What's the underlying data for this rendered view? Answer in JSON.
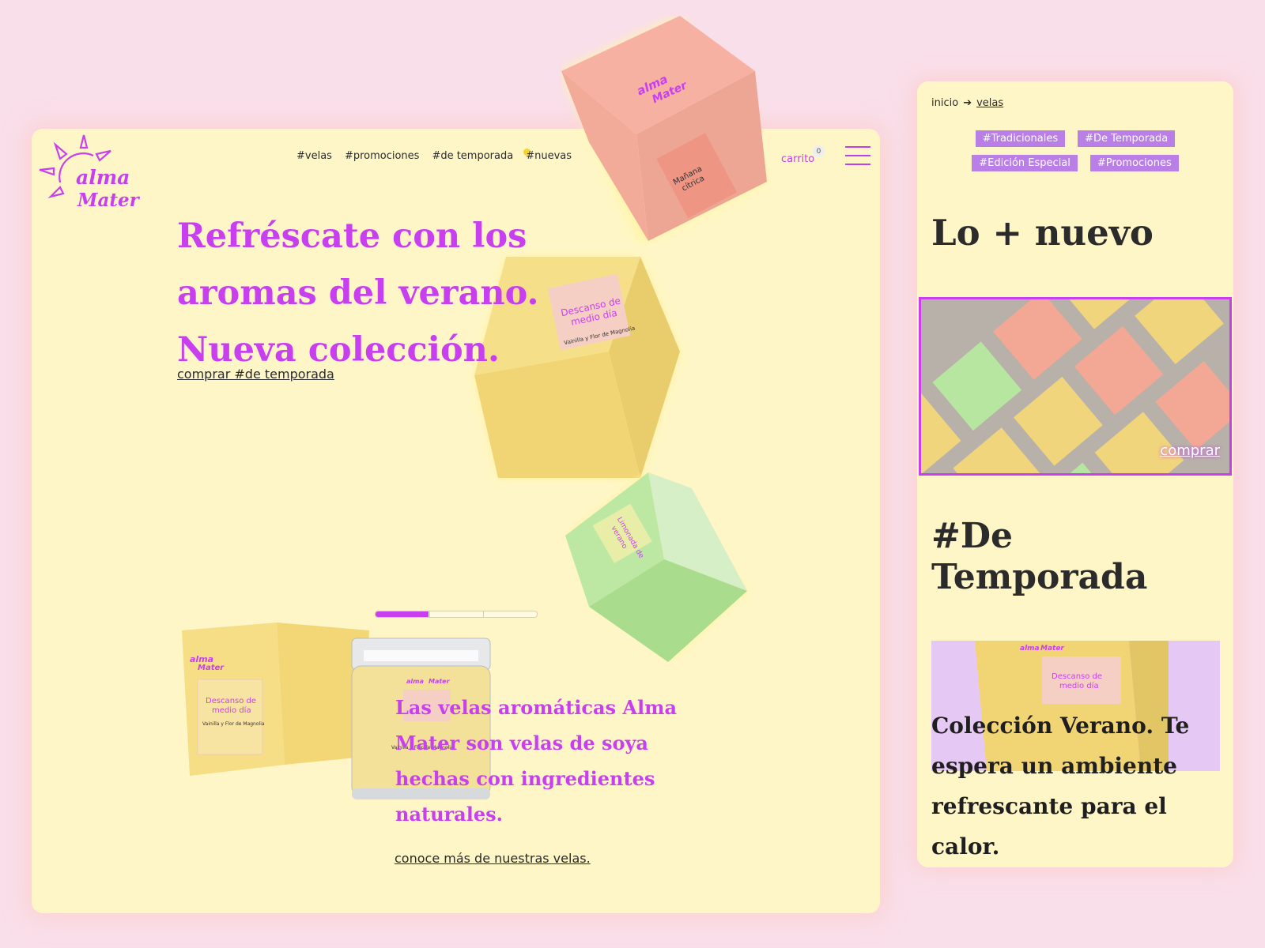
{
  "brand": {
    "logo_line1": "alma",
    "logo_line2": "Mater"
  },
  "nav": {
    "items": [
      "#velas",
      "#promociones",
      "#de temporada",
      "#nuevas"
    ]
  },
  "cart": {
    "label": "carrito",
    "count": "0"
  },
  "hero": {
    "title": "Refréscate con los aromas del verano. Nueva colección.",
    "link": "comprar #de temporada"
  },
  "carousel": {
    "progress": 0.33
  },
  "about": {
    "text": "Las velas aromáticas Alma Mater son velas de soya hechas con ingredientes naturales.",
    "link": "conoce más de nuestras velas."
  },
  "products": {
    "box_label_line1": "Descanso de",
    "box_label_line2": "medio día",
    "box_sublabel": "Vainilla y Flor de Magnolia",
    "pink_label_line1": "Mañana",
    "pink_label_line2": "cítrica",
    "green_label_line1": "Limonada de",
    "green_label_line2": "verano"
  },
  "mobile": {
    "breadcrumb": {
      "home": "inicio",
      "current": "velas"
    },
    "tags": [
      "#Tradicionales",
      "#De Temporada",
      "#Edición Especial",
      "#Promociones"
    ],
    "new_heading": "Lo + nuevo",
    "buy": "comprar",
    "season_heading": "#De Temporada",
    "season_text": "Colección Verano. Te espera un ambiente refrescante para el calor."
  },
  "colors": {
    "background": "#f9dfea",
    "card": "#fff6c7",
    "accent": "#c83ff0",
    "tag": "#b97fe6",
    "yellow_box": "#f4dc86",
    "pink_box": "#f3a795",
    "green_box": "#b7e6a0"
  }
}
